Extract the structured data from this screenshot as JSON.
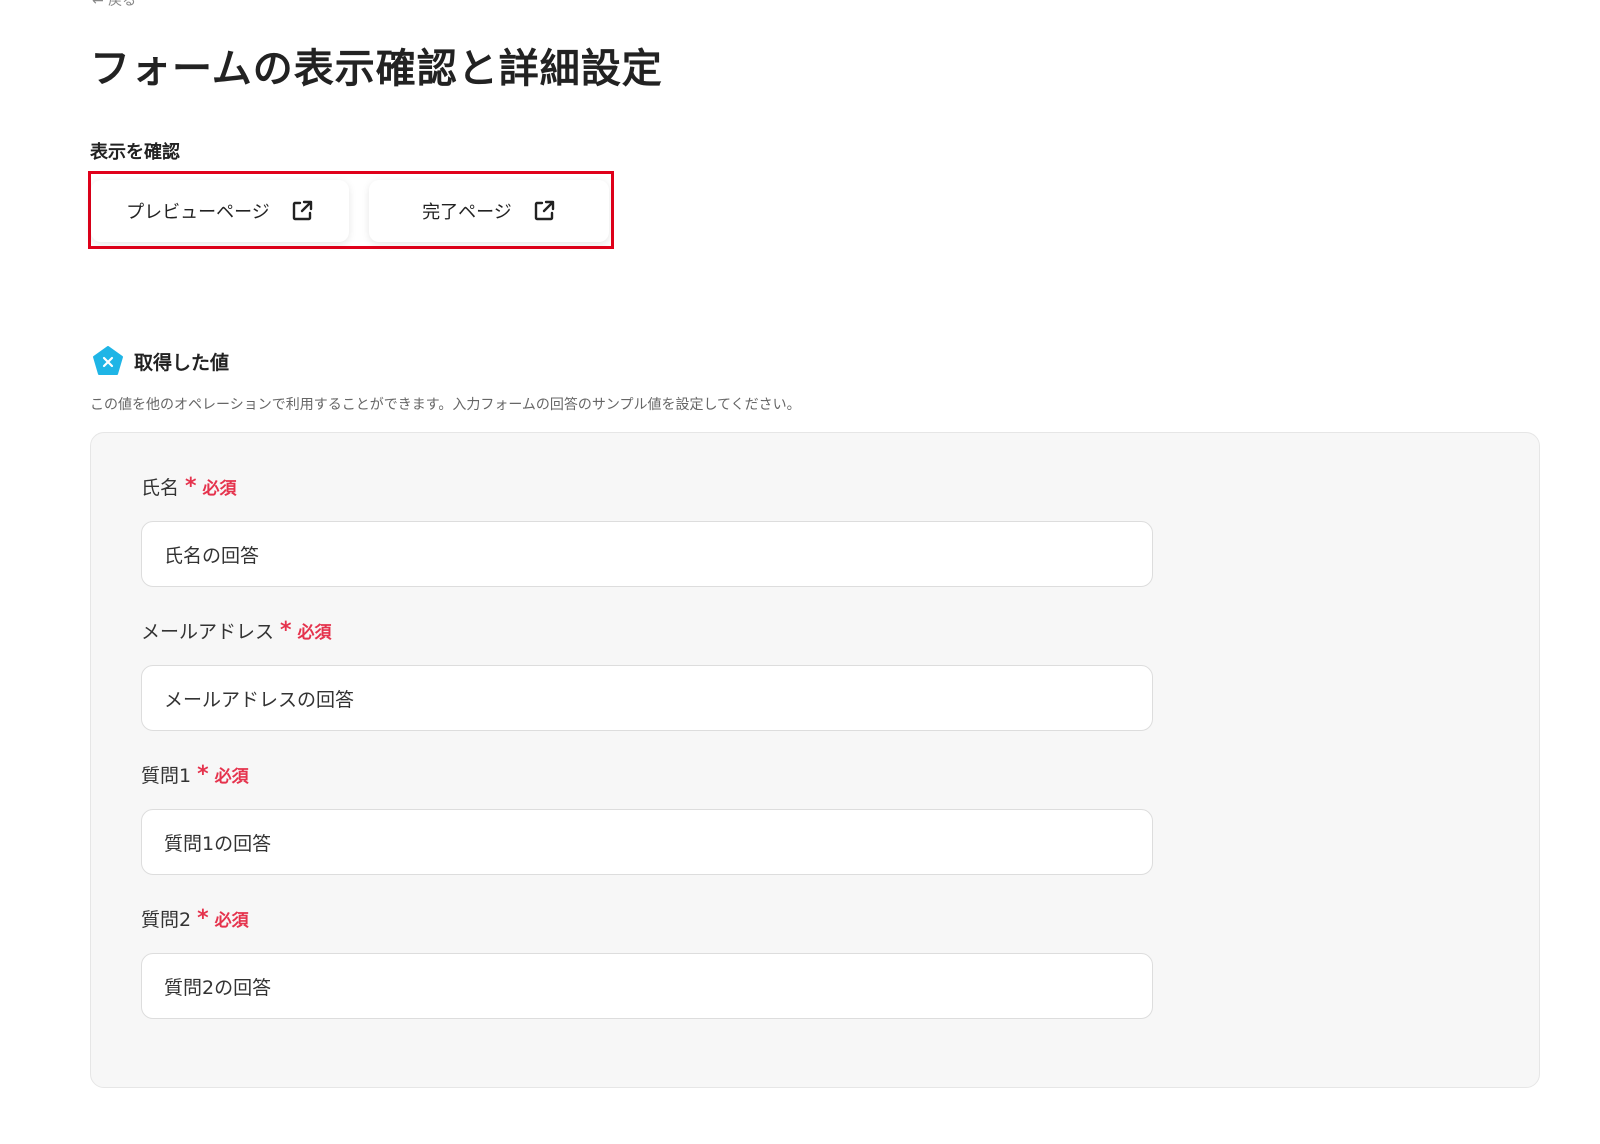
{
  "header": {
    "back_label": "← 戻る",
    "title": "フォームの表示確認と詳細設定"
  },
  "preview_section": {
    "label": "表示を確認",
    "buttons": [
      {
        "label": "プレビューページ",
        "icon": "external-link-icon"
      },
      {
        "label": "完了ページ",
        "icon": "external-link-icon"
      }
    ],
    "highlight_color": "#e0001a"
  },
  "values_section": {
    "icon": "pentagon-x-icon",
    "icon_color": "#1fb5e6",
    "title": "取得した値",
    "description": "この値を他のオペレーションで利用することができます。入力フォームの回答のサンプル値を設定してください。"
  },
  "fields": [
    {
      "label": "氏名",
      "required_mark": "*",
      "required_text": "必須",
      "value": "氏名の回答"
    },
    {
      "label": "メールアドレス",
      "required_mark": "*",
      "required_text": "必須",
      "value": "メールアドレスの回答"
    },
    {
      "label": "質問1",
      "required_mark": "*",
      "required_text": "必須",
      "value": "質問1の回答"
    },
    {
      "label": "質問2",
      "required_mark": "*",
      "required_text": "必須",
      "value": "質問2の回答"
    }
  ]
}
